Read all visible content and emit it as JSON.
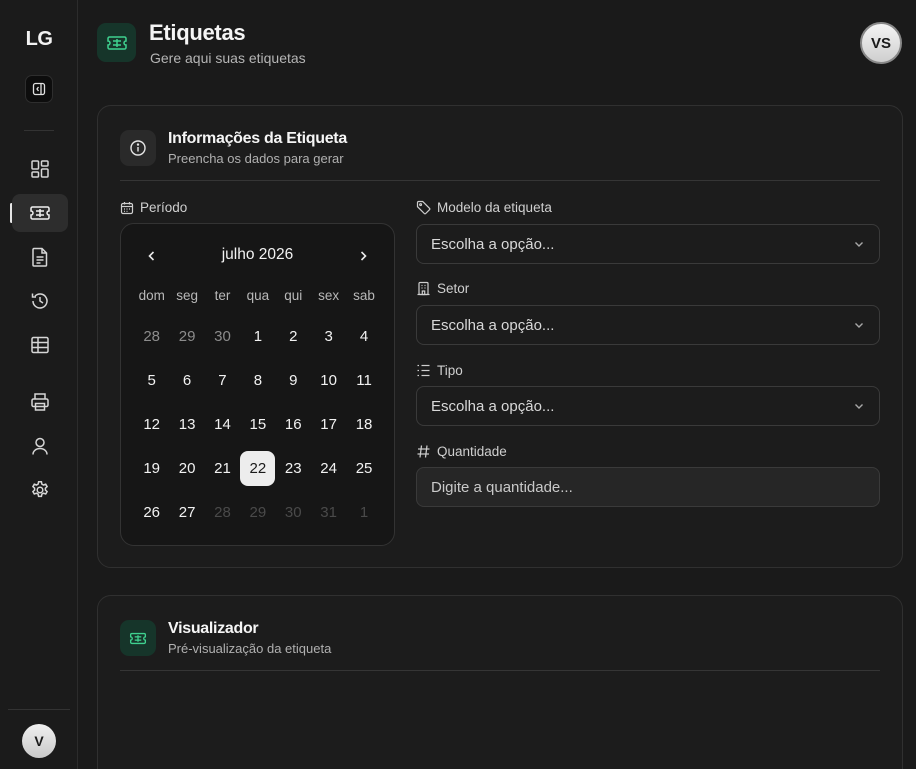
{
  "sidebar": {
    "logo": "LG",
    "items": [
      {
        "name": "dashboard",
        "icon": "dashboard-icon",
        "active": false
      },
      {
        "name": "labels",
        "icon": "ticket-icon",
        "active": true
      },
      {
        "name": "documents",
        "icon": "document-icon",
        "active": false
      },
      {
        "name": "history",
        "icon": "history-icon",
        "active": false
      },
      {
        "name": "table",
        "icon": "table-icon",
        "active": false
      },
      {
        "name": "print",
        "icon": "printer-icon",
        "active": false
      },
      {
        "name": "users",
        "icon": "user-icon",
        "active": false
      },
      {
        "name": "settings",
        "icon": "gear-icon",
        "active": false
      }
    ],
    "avatar_initial": "V"
  },
  "header": {
    "title": "Etiquetas",
    "subtitle": "Gere aqui suas etiquetas",
    "user_initials": "VS"
  },
  "info_card": {
    "title": "Informações da Etiqueta",
    "subtitle": "Preencha os dados para gerar",
    "period_label": "Período",
    "calendar": {
      "month": "julho 2026",
      "weekdays": [
        "dom",
        "seg",
        "ter",
        "qua",
        "qui",
        "sex",
        "sab"
      ],
      "weeks": [
        [
          "28",
          "29",
          "30",
          "1",
          "2",
          "3",
          "4"
        ],
        [
          "5",
          "6",
          "7",
          "8",
          "9",
          "10",
          "11"
        ],
        [
          "12",
          "13",
          "14",
          "15",
          "16",
          "17",
          "18"
        ],
        [
          "19",
          "20",
          "21",
          "22",
          "23",
          "24",
          "25"
        ],
        [
          "26",
          "27",
          "28",
          "29",
          "30",
          "31",
          "1"
        ]
      ],
      "selected_day": "22"
    },
    "model": {
      "label": "Modelo da etiqueta",
      "placeholder": "Escolha a opção..."
    },
    "sector": {
      "label": "Setor",
      "placeholder": "Escolha a opção..."
    },
    "type": {
      "label": "Tipo",
      "placeholder": "Escolha a opção..."
    },
    "quantity": {
      "label": "Quantidade",
      "placeholder": "Digite a quantidade..."
    }
  },
  "viewer_card": {
    "title": "Visualizador",
    "subtitle": "Pré-visualização da etiqueta"
  },
  "colors": {
    "accent_green": "#3fd18f",
    "background": "#1a1a1a",
    "card": "#1c1c1c"
  }
}
